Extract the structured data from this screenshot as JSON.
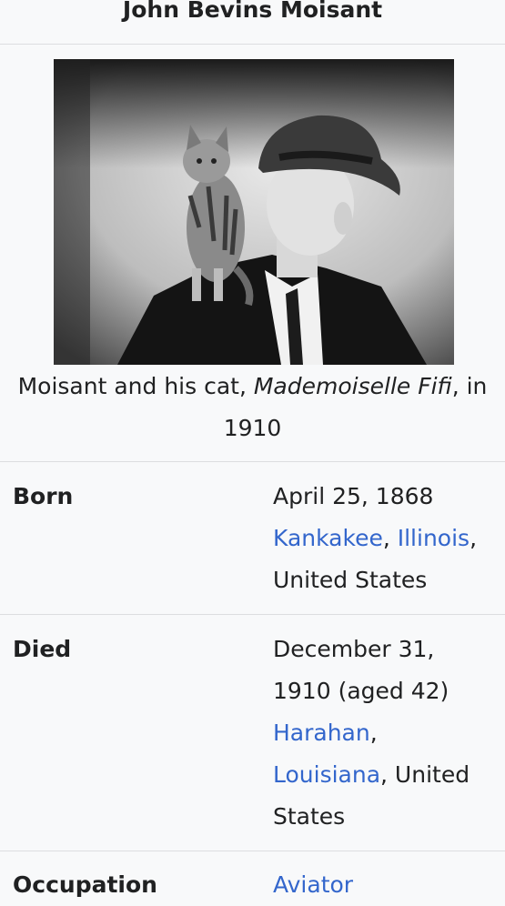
{
  "infobox": {
    "title": "John Bevins Moisant",
    "caption": {
      "prefix": "Moisant and his cat, ",
      "italic": "Mademoiselle Fifi",
      "suffix": ", in",
      "line2": "1910"
    },
    "rows": [
      {
        "label": "Born",
        "date": "April 25, 1868",
        "place_link_1": "Kankakee",
        "place_sep_1": ", ",
        "place_link_2": "Illinois",
        "place_sep_2": ",",
        "place_rest": "United States"
      },
      {
        "label": "Died",
        "date_line1": "December 31,",
        "date_line2": "1910 (aged 42)",
        "place_link_1": "Harahan",
        "place_sep_1": ",",
        "place_link_2": "Louisiana",
        "place_sep_2": ", United",
        "place_rest": "States"
      },
      {
        "label": "Occupation",
        "value_link": "Aviator"
      }
    ]
  },
  "colors": {
    "background": "#f8f9fa",
    "text": "#202122",
    "link": "#3366cc",
    "divider": "#dcdde0"
  }
}
